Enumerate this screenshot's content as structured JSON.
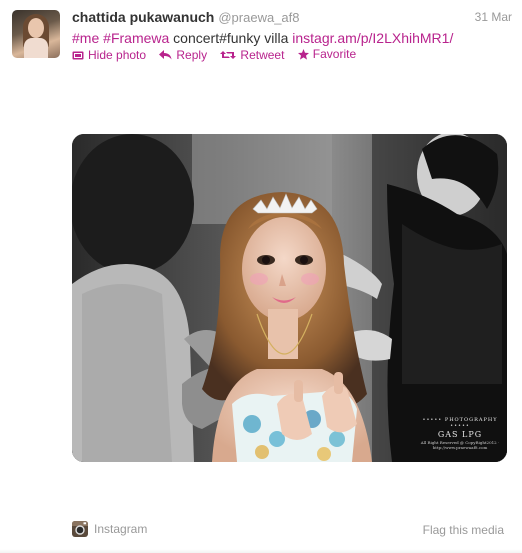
{
  "tweet": {
    "fullname": "chattida pukawanuch",
    "username": "@praewa_af8",
    "timestamp": "31 Mar",
    "text": {
      "tag1": "me",
      "tag2": "Framewa",
      "middle": " concert#funky villa ",
      "link": "instagr.am/p/I2LXhihMR1/"
    },
    "actions": {
      "hide_photo": "Hide photo",
      "reply": "Reply",
      "retweet": "Retweet",
      "favorite": "Favorite"
    },
    "media": {
      "watermark_line1": "••••• PHOTOGRAPHY •••••",
      "watermark_line2": "GAS LPG",
      "watermark_line3": "All Right Reserved @ CopyRight2012 · http://www.praewaaf8.com"
    },
    "footer": {
      "provider": "Instagram",
      "flag": "Flag this media"
    }
  },
  "colors": {
    "link": "#b8238d",
    "muted": "#999999",
    "text": "#333333"
  }
}
